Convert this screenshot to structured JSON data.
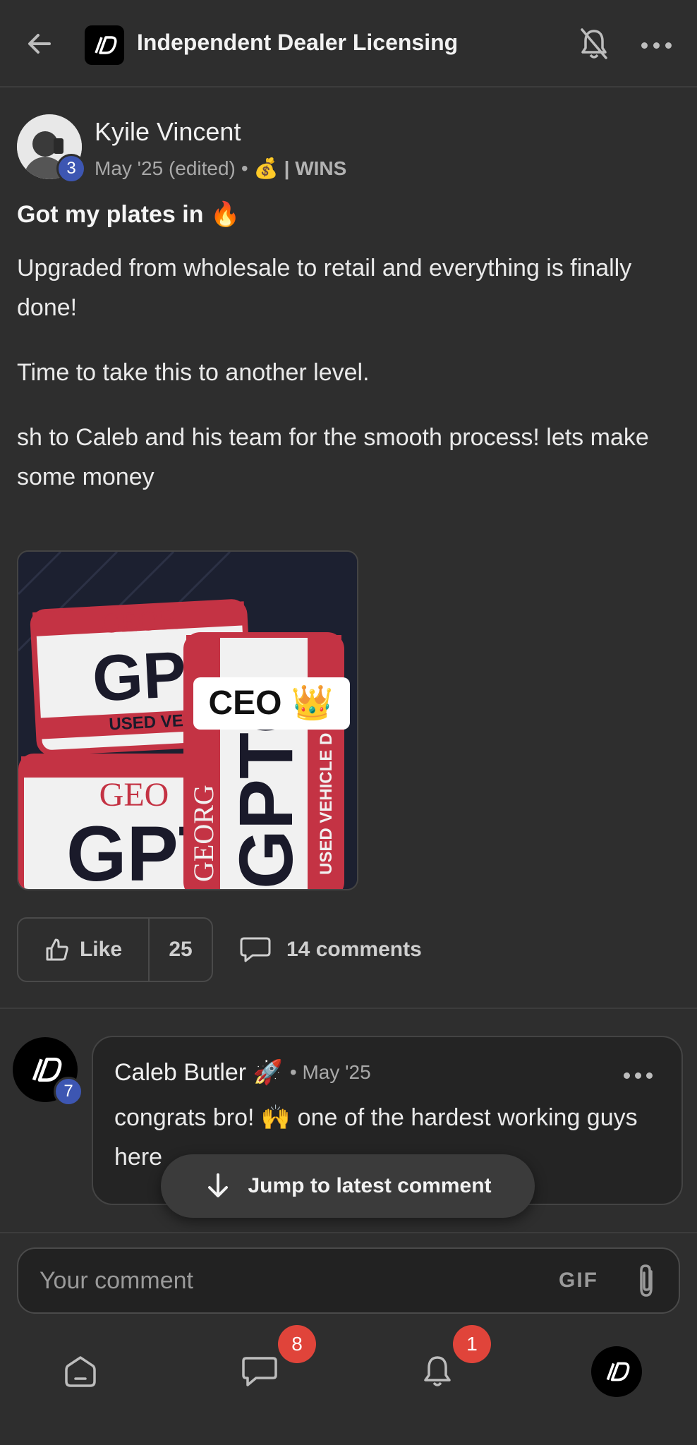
{
  "header": {
    "title": "Independent Dealer Licensing",
    "logo_text": "ID"
  },
  "post": {
    "author": {
      "name": "Kyile Vincent",
      "level": "3",
      "date": "May '25 (edited)",
      "separator": "•",
      "category_emoji": "💰",
      "category": "| WINS"
    },
    "title": "Got my plates in 🔥",
    "paragraphs": [
      "Upgraded from wholesale to retail and everything is finally done!",
      "Time to take this to another level.",
      "sh to Caleb and his team for the smooth process! lets make some money"
    ],
    "image": {
      "caption": "CEO 👑",
      "plate_state": "GEOR",
      "plate_number": "GPT",
      "plate_type": "USED VEHICLE D"
    },
    "like_label": "Like",
    "like_count": "25",
    "comments_label": "14 comments"
  },
  "comment": {
    "author": "Caleb Butler 🚀",
    "level": "7",
    "time": "• May '25",
    "text": "congrats bro! 🙌 one of the hardest working guys here"
  },
  "jump_label": "Jump to latest comment",
  "composer": {
    "placeholder": "Your comment",
    "gif_label": "GIF"
  },
  "nav": {
    "chat_badge": "8",
    "notifications_badge": "1"
  },
  "colors": {
    "background": "#2e2e2e",
    "badge_blue": "#3d56b2",
    "notification_red": "#e0443a"
  }
}
